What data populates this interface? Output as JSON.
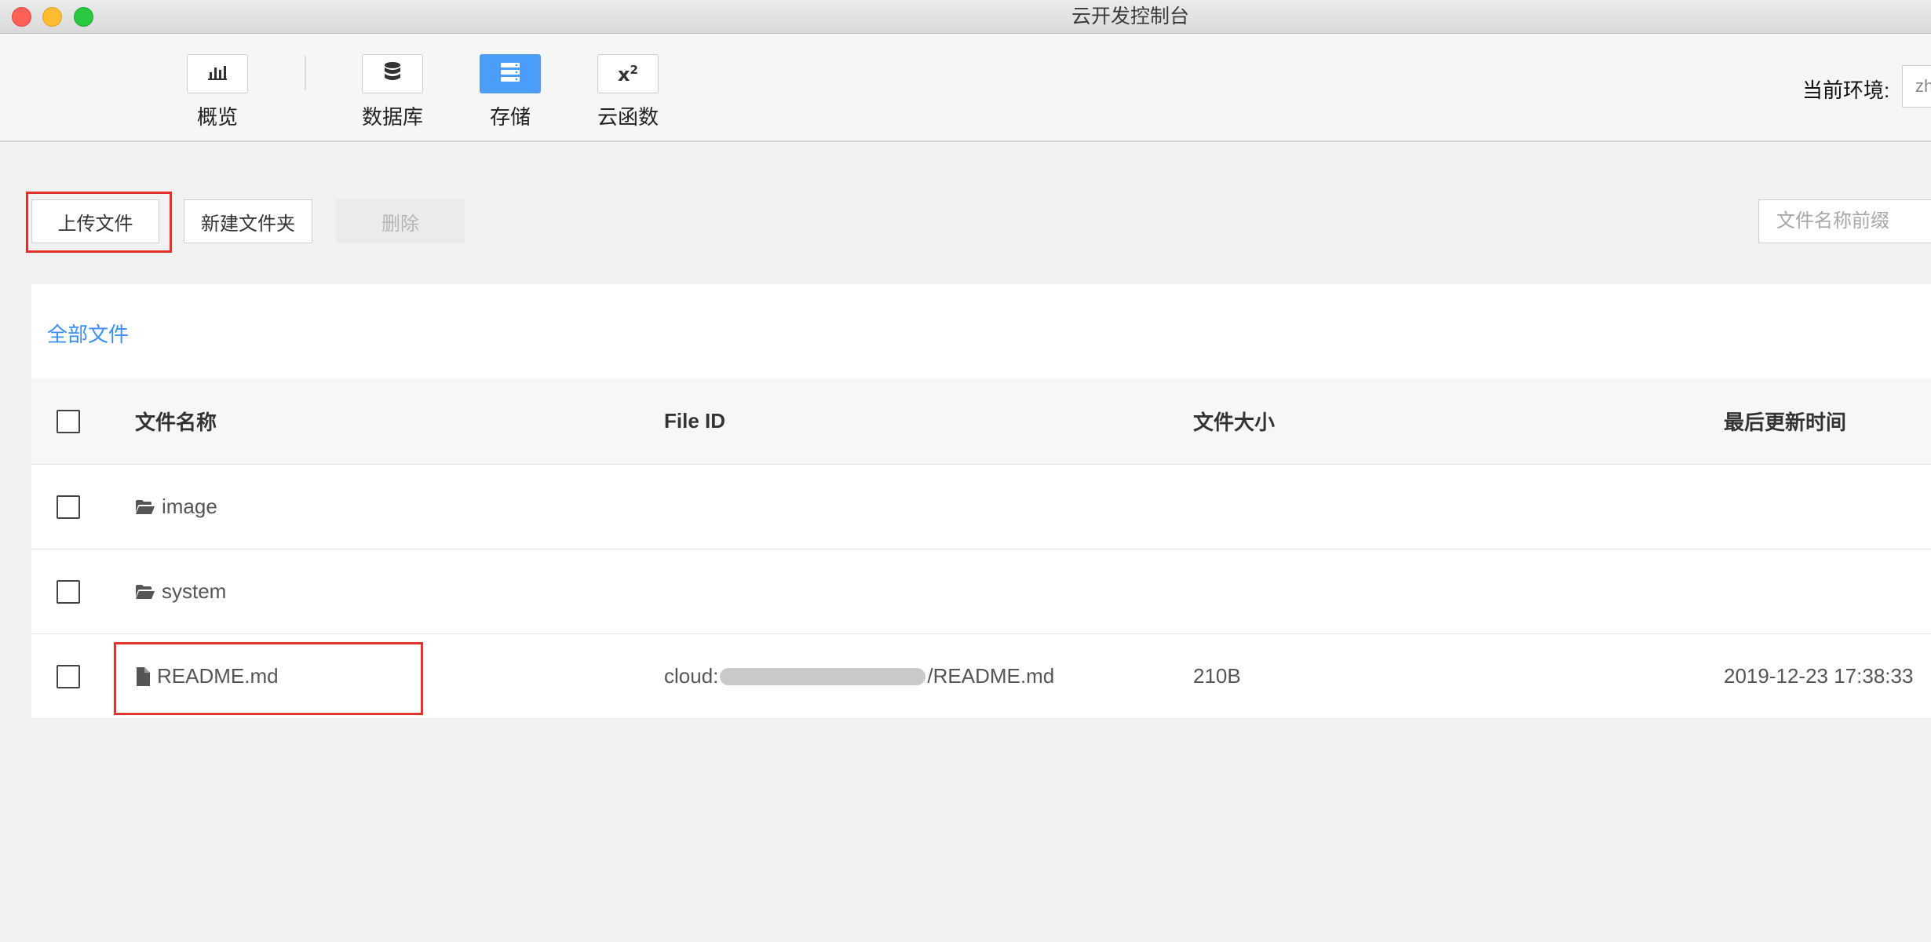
{
  "window": {
    "title": "云开发控制台"
  },
  "toolbar": {
    "items": [
      {
        "label": "概览",
        "icon": "bar-chart-icon",
        "active": false
      },
      {
        "label": "数据库",
        "icon": "database-icon",
        "active": false
      },
      {
        "label": "存储",
        "icon": "storage-icon",
        "active": true
      },
      {
        "label": "云函数",
        "icon": "function-icon",
        "active": false
      }
    ],
    "function_glyph": "x",
    "function_sup": "2",
    "env_label": "当前环境:",
    "env_value": "zh"
  },
  "actions": {
    "upload_label": "上传文件",
    "new_folder_label": "新建文件夹",
    "delete_label": "删除",
    "search_placeholder": "文件名称前缀"
  },
  "breadcrumb": {
    "label": "全部文件"
  },
  "table": {
    "columns": [
      "文件名称",
      "File ID",
      "文件大小",
      "最后更新时间"
    ],
    "rows": [
      {
        "type": "folder",
        "icon": "folder-open-icon",
        "name": "image",
        "file_id_prefix": "",
        "file_id_suffix": "",
        "size": "",
        "updated": ""
      },
      {
        "type": "folder",
        "icon": "folder-open-icon",
        "name": "system",
        "file_id_prefix": "",
        "file_id_suffix": "",
        "size": "",
        "updated": ""
      },
      {
        "type": "file",
        "icon": "file-icon",
        "name": "README.md",
        "file_id_prefix": "cloud:",
        "file_id_suffix": "/README.md",
        "size": "210B",
        "updated": "2019-12-23 17:38:33"
      }
    ]
  },
  "colors": {
    "accent": "#4c9df8",
    "link": "#3b8ff0",
    "highlight": "#e0342b",
    "background": "#f2f2f2"
  }
}
